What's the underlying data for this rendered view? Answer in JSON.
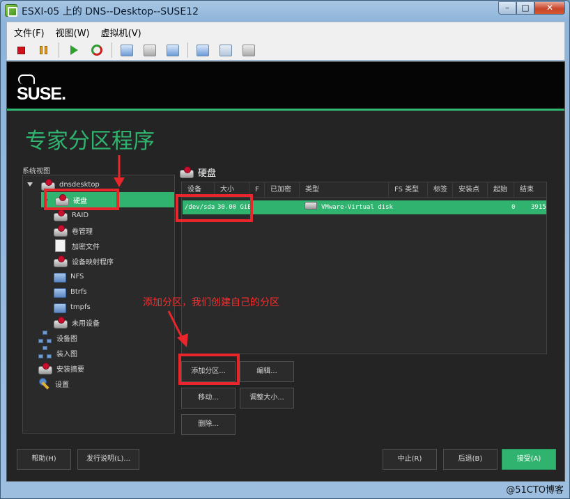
{
  "window": {
    "title": "ESXI-05 上的 DNS--Desktop--SUSE12",
    "controls": {
      "minimize": "–",
      "maximize": "□",
      "close": "✕"
    }
  },
  "menubar": {
    "items": [
      "文件(F)",
      "视图(W)",
      "虚拟机(V)"
    ]
  },
  "toolbar": {
    "icons": [
      "stop-icon",
      "pause-icon",
      "play-icon",
      "reset-icon",
      "snapshot-icon",
      "revert-snapshot-icon",
      "snapshot-manager-icon",
      "console-settings-icon",
      "network-icon",
      "disk-tools-icon"
    ]
  },
  "suse": {
    "logo_text": "SUSE."
  },
  "page": {
    "title": "专家分区程序"
  },
  "sidebar": {
    "label": "系统视图",
    "items": [
      {
        "label": "dnsdesktop",
        "icon": "host-disk-icon"
      },
      {
        "label": "硬盘",
        "icon": "harddisk-icon",
        "selected": true
      },
      {
        "label": "RAID",
        "icon": "raid-icon"
      },
      {
        "label": "卷管理",
        "icon": "volume-manager-icon"
      },
      {
        "label": "加密文件",
        "icon": "encrypted-file-icon"
      },
      {
        "label": "设备映射程序",
        "icon": "device-mapper-icon"
      },
      {
        "label": "NFS",
        "icon": "folder-icon"
      },
      {
        "label": "Btrfs",
        "icon": "folder-icon"
      },
      {
        "label": "tmpfs",
        "icon": "folder-icon"
      },
      {
        "label": "未用设备",
        "icon": "unused-device-icon"
      },
      {
        "label": "设备图",
        "icon": "device-graph-icon"
      },
      {
        "label": "装入图",
        "icon": "mount-graph-icon"
      },
      {
        "label": "安装摘要",
        "icon": "install-summary-icon"
      },
      {
        "label": "设置",
        "icon": "settings-icon"
      }
    ]
  },
  "panel": {
    "title": "硬盘",
    "columns": [
      "设备",
      "大小",
      "F",
      "已加密",
      "类型",
      "FS 类型",
      "标签",
      "安装点",
      "起始",
      "结束"
    ],
    "rows": [
      {
        "device": "/dev/sda",
        "size": "30.00 GiB",
        "f": "",
        "encrypted": "",
        "type": "VMware-Virtual disk",
        "fs_type": "",
        "label": "",
        "mount": "",
        "start": "0",
        "end": "3915"
      }
    ]
  },
  "buttons": {
    "add_partition": "添加分区...",
    "edit": "编辑...",
    "move": "移动...",
    "resize": "调整大小...",
    "delete": "删除..."
  },
  "footer": {
    "help": "帮助(H)",
    "release_notes": "发行说明(L)...",
    "abort": "中止(R)",
    "back": "后退(B)",
    "accept": "接受(A)"
  },
  "annotation": {
    "text": "添加分区，我们创建自己的分区"
  },
  "watermark": {
    "text": "@51CTO博客"
  },
  "colors": {
    "accent_green": "#2fb36e",
    "annotation_red": "#e8262b",
    "console_bg": "#242424"
  }
}
